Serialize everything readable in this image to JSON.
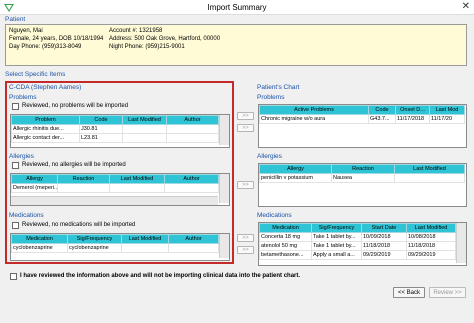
{
  "window": {
    "title": "Import Summary"
  },
  "patient": {
    "label": "Patient",
    "name": "Nguyen, Mai",
    "demographics": "Female, 24 years, DOB 10/18/1994",
    "day_phone": "Day Phone: (959)313-8049",
    "account": "Account #: 1321958",
    "address": "Address: 500 Oak Grove, Hartford, 00000",
    "night_phone": "Night Phone: (959)215-9001"
  },
  "select_label": "Select Specific Items",
  "left": {
    "source_title": "C-CDA (Stephen Aames)",
    "problems": {
      "heading": "Problems",
      "checkbox_label": "Reviewed, no problems will be imported",
      "columns": [
        "Problem",
        "Code",
        "Last Modified",
        "Author"
      ],
      "rows": [
        [
          "Allergic rhinitis due...",
          "J30.81",
          "",
          ""
        ],
        [
          "Allergic contact der...",
          "L23.81",
          "",
          ""
        ]
      ]
    },
    "allergies": {
      "heading": "Allergies",
      "checkbox_label": "Reviewed, no allergies will be imported",
      "columns": [
        "Allergy",
        "Reaction",
        "Last Modified",
        "Author"
      ],
      "rows": [
        [
          "Demerol (meperi...",
          "",
          "",
          ""
        ]
      ]
    },
    "medications": {
      "heading": "Medications",
      "checkbox_label": "Reviewed, no medications will be imported",
      "columns": [
        "Medication",
        "Sig/Frequency",
        "Last Modified",
        "Author"
      ],
      "rows": [
        [
          "cyclobenzaprine",
          "cyclobenzaprine",
          "",
          ""
        ]
      ]
    }
  },
  "arrows": {
    "label": ">>"
  },
  "right": {
    "chart_title": "Patient's Chart",
    "problems": {
      "heading": "Problems",
      "columns": [
        "Active Problems",
        "Code",
        "Onset D...",
        "Last Mod"
      ],
      "rows": [
        [
          "Chronic migraine w/o aura",
          "G43.7...",
          "11/17/2018",
          "11/17/20"
        ]
      ]
    },
    "allergies": {
      "heading": "Allergies",
      "columns": [
        "Allergy",
        "Reaction",
        "Last Modified"
      ],
      "rows": [
        [
          "penicillin v potassium",
          "Nausea",
          ""
        ]
      ]
    },
    "medications": {
      "heading": "Medications",
      "columns": [
        "Medication",
        "Sig/Frequency",
        "Start Date",
        "Last Modified"
      ],
      "rows": [
        [
          "Concerta 18 mg",
          "Take 1 tablet by...",
          "10/09/2018",
          "10/08/2018"
        ],
        [
          "atenolol 50 mg",
          "Take 1 tablet by...",
          "11/18/2018",
          "11/18/2018"
        ],
        [
          "betamethasone...",
          "Apply a small a...",
          "09/29/2019",
          "09/29/2019"
        ]
      ]
    }
  },
  "footer": {
    "confirm_label": "I have reviewed the information above and will not be importing clinical data into the patient chart.",
    "back_label": "<< Back",
    "review_label": "Review >>"
  }
}
